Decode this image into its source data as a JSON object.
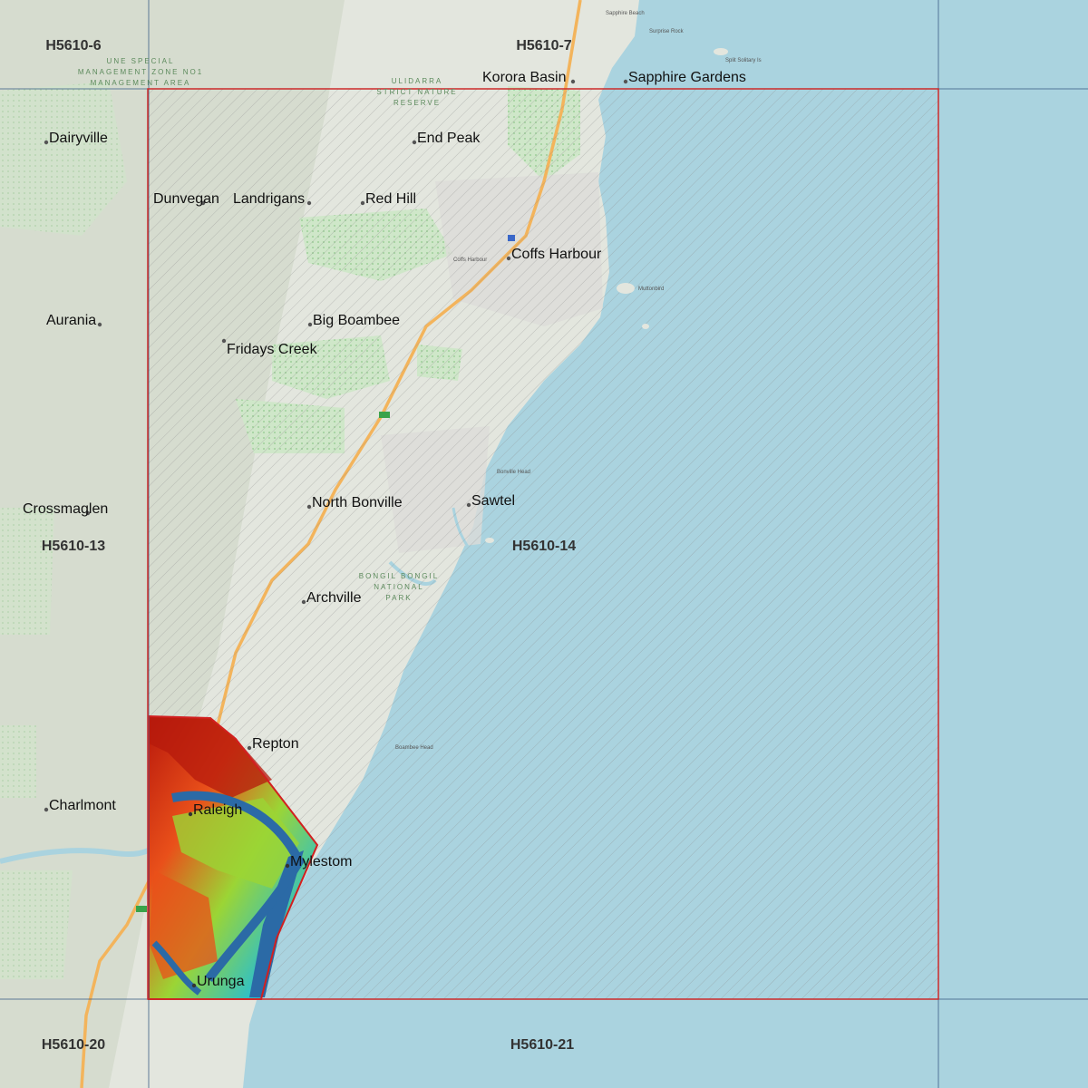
{
  "colors": {
    "sea": "#aad3df",
    "land": "#e6e9e1",
    "coverage_outline": "#cc2a2a",
    "grid_line": "#3d5f86",
    "highway": "#f3b45c"
  },
  "grid_tiles": [
    "H5610-6",
    "H5610-7",
    "H5610-13",
    "H5610-14",
    "H5610-20",
    "H5610-21"
  ],
  "places": [
    "Korora Basin",
    "Sapphire Gardens",
    "Dairyville",
    "End Peak",
    "Dunvegan",
    "Landrigans",
    "Red Hill",
    "Coffs Harbour",
    "Aurania",
    "Big Boambee",
    "Fridays Creek",
    "Crossmaglen",
    "North Bonville",
    "Sawtel",
    "Archville",
    "Repton",
    "Charlmont",
    "Raleigh",
    "Mylestom",
    "Urunga"
  ],
  "area_labels": [
    "UNE SPECIAL",
    "MANAGEMENT ZONE NO1",
    "MANAGEMENT AREA",
    "ULIDARRA",
    "STRICT NATURE",
    "RESERVE",
    "BONGIL BONGIL",
    "NATIONAL",
    "PARK"
  ],
  "minor_labels": [
    "Coffs Harbour",
    "Muttonbird",
    "Bonville Head",
    "Sapphire Beach",
    "Split Solitary Is",
    "Boambee Head",
    "Surprise Rock"
  ],
  "icons": [
    "town-dot-icon",
    "highway-shield-icon"
  ]
}
